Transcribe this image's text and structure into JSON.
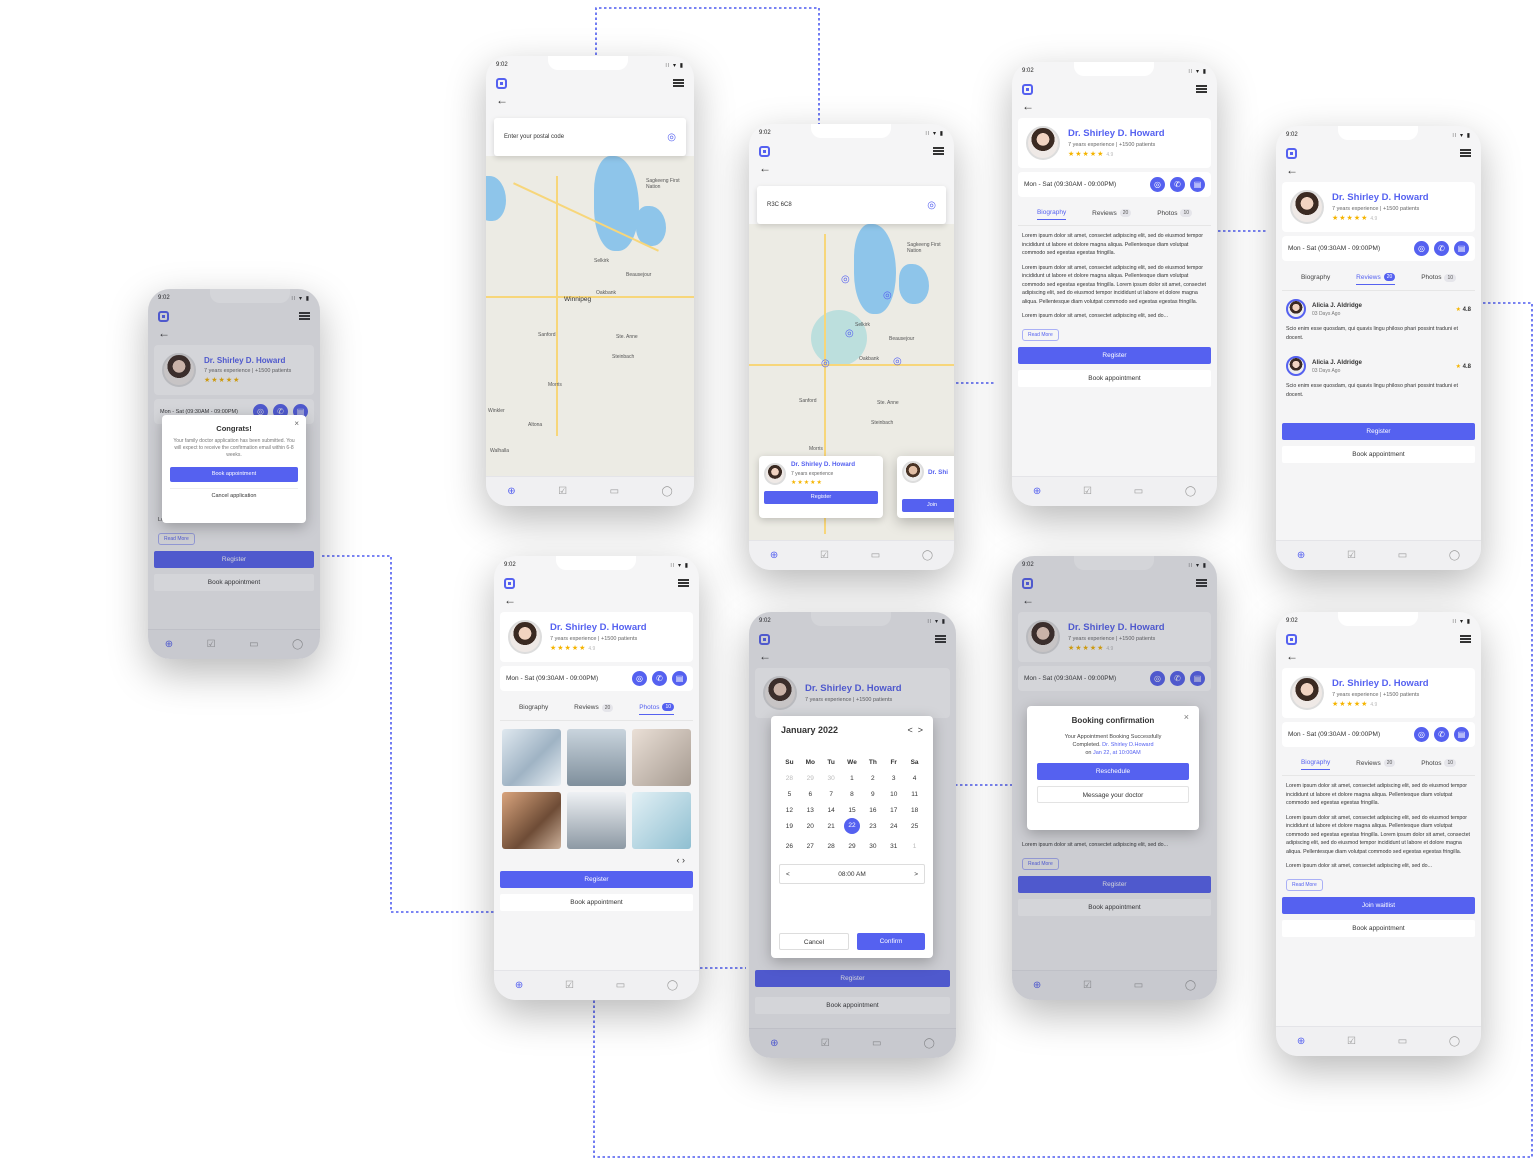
{
  "status": {
    "time": "9:02",
    "signal": "∷ ▾ ▮"
  },
  "icons": {
    "back": "←",
    "pin": "◎",
    "phone": "✆",
    "chat": "▤",
    "nav": [
      "⊕",
      "☑",
      "▭",
      "◯"
    ]
  },
  "colors": {
    "accent": "#5561f0",
    "star": "#f5b400",
    "connector": "#4e5cf0"
  },
  "doctor": {
    "name": "Dr. Shirley D. Howard",
    "experience": "7 years experience",
    "patients": "+1500 patients",
    "stars": "★★★★★",
    "rating": "4.9",
    "hours": "Mon - Sat (09:30AM - 09:00PM)"
  },
  "tabs": {
    "biography": "Biography",
    "reviews": "Reviews",
    "reviews_count": "20",
    "photos": "Photos",
    "photos_count": "10"
  },
  "bio": {
    "p1": "Lorem ipsum dolor sit amet, consectet adipiscing elit, sed do eiusmod tempor incididunt ut labore et dolore magna aliqua. Pellentesque diam volutpat commodo sed egestas egestas fringilla.",
    "p2": "Lorem ipsum dolor sit amet, consectet adipiscing elit, sed do eiusmod tempor incididunt ut labore et dolore magna aliqua. Pellentesque diam volutpat commodo sed egestas egestas fringilla. Lorem ipsum dolor sit amet, consectet adipiscing elit, sed do eiusmod tempor incididunt ut labore et dolore magna aliqua. Pellentesque diam volutpat commodo sed egestas egestas fringilla.",
    "p3": "Lorem ipsum dolor sit amet, consectet adipiscing elit, sed do...",
    "read_more": "Read More"
  },
  "buttons": {
    "register": "Register",
    "book": "Book appointment",
    "join_waitlist": "Join waitlist",
    "join": "Join"
  },
  "congrats": {
    "title": "Congrats!",
    "text": "Your family doctor application has been submitted. You will expect to receive the confirmation email within 6-8 weeks.",
    "book": "Book appointment",
    "cancel": "Cancel application",
    "close": "×"
  },
  "map": {
    "placeholder": "Enter your postal code",
    "postal": "R3C 6C8",
    "places": [
      "Sagkeeng First Nation",
      "Selkirk",
      "Beausejour",
      "Winnipeg",
      "Oakbank",
      "Sanford",
      "Ste. Anne",
      "Steinbach",
      "Morris",
      "Winkler",
      "Altona",
      "Walhalla"
    ],
    "mini_doctor": "Dr. Shi"
  },
  "reviews": [
    {
      "name": "Alicia J. Aldridge",
      "ago": "03 Days Ago",
      "score": "4.8",
      "text": "Scio enim esse quosdam, qui quavis lingu philoso phari possint traduni et docent."
    },
    {
      "name": "Alicia J. Aldridge",
      "ago": "03 Days Ago",
      "score": "4.8",
      "text": "Scio enim esse quosdam, qui quavis lingu philoso phari possint traduni et docent."
    }
  ],
  "calendar": {
    "month": "January 2022",
    "prev": "<",
    "next": ">",
    "weekdays": [
      "Su",
      "Mo",
      "Tu",
      "We",
      "Th",
      "Fr",
      "Sa"
    ],
    "days": [
      "28",
      "29",
      "30",
      "1",
      "2",
      "3",
      "4",
      "5",
      "6",
      "7",
      "8",
      "9",
      "10",
      "11",
      "12",
      "13",
      "14",
      "15",
      "16",
      "17",
      "18",
      "19",
      "20",
      "21",
      "22",
      "23",
      "24",
      "25",
      "26",
      "27",
      "28",
      "29",
      "30",
      "31",
      "1"
    ],
    "muted": [
      0,
      1,
      2,
      34
    ],
    "selected": 24,
    "time": "08:00 AM",
    "cancel": "Cancel",
    "confirm": "Confirm"
  },
  "booking": {
    "title": "Booking confirmation",
    "line1": "Your Appointment Booking Successfully",
    "line2_pre": "Completed.",
    "line2_doc": "Dr. Shirley D.Howard",
    "line3_pre": "on",
    "line3_date": "Jan 22, at 10:00AM",
    "reschedule": "Reschedule",
    "message": "Message your doctor",
    "close": "×"
  },
  "pager": "‹  ›"
}
